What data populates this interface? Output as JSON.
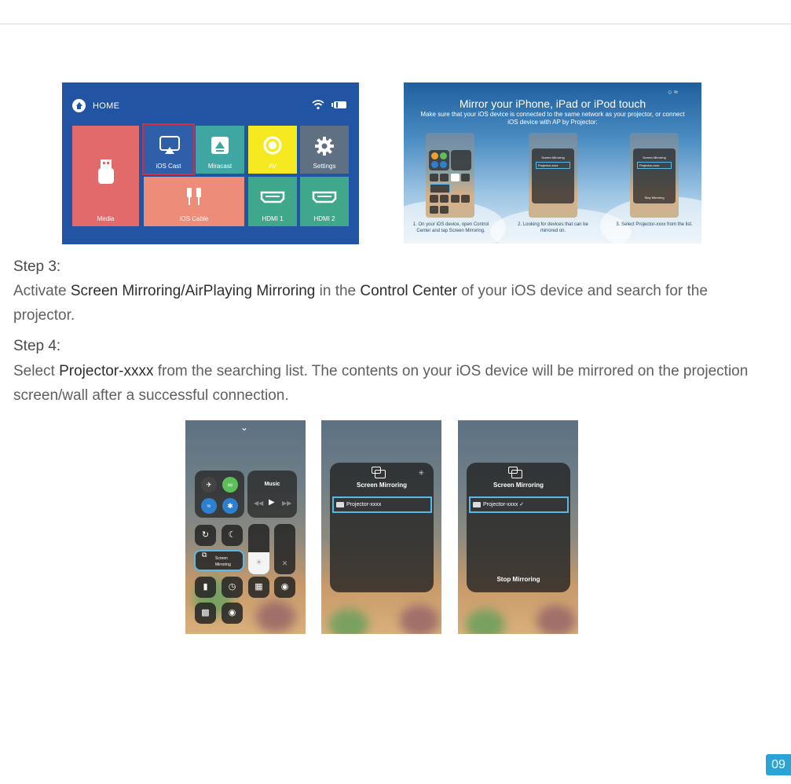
{
  "home_screen": {
    "title": "HOME",
    "tiles": {
      "media": "Media",
      "ios_cast": "iOS Cast",
      "miracast": "Miracast",
      "av": "AV",
      "settings": "Settings",
      "ios_cable": "iOS Cable",
      "hdmi1": "HDMI 1",
      "hdmi2": "HDMI 2"
    },
    "colors": {
      "background": "#2154a3",
      "highlight": "#d72d3b"
    }
  },
  "mirror_guide": {
    "title": "Mirror your iPhone, iPad or iPod touch",
    "subtitle": "Make sure that your iOS device is connected to the same network as your projector, or connect iOS device with AP by Projector:",
    "captions": [
      "1. On your iOS device, open Control Center and tap Screen Mirroring.",
      "2. Looking for devices that can be mirrored on.",
      "3. Select Projector-xxxx from the list."
    ],
    "mini_title": "Screen Mirroring",
    "mini_item": "Projector-xxxx",
    "mini_stop": "Stop Mirroring"
  },
  "step3": {
    "heading": "Step 3:",
    "t1": "Activate ",
    "b1": "Screen Mirroring/AirPlaying Mirroring",
    "t2": " in the ",
    "b2": "Control Center",
    "t3": " of your iOS device and search for the projector."
  },
  "step4": {
    "heading": "Step 4:",
    "t1": "Select ",
    "b1": "Projector-xxxx",
    "t2": " from the searching list. The contents on your iOS device will be mirrored on the projection screen/wall after a successful connection."
  },
  "phone1": {
    "music": "Music",
    "screen_mirroring_small": "Screen Mirroring"
  },
  "phone2": {
    "title": "Screen Mirroring",
    "item": "Projector-xxxx"
  },
  "phone3": {
    "title": "Screen Mirroring",
    "item": "Projector-xxxx",
    "stop": "Stop Mirroring"
  },
  "page_number": "09",
  "accent_color": "#2aa4d6"
}
